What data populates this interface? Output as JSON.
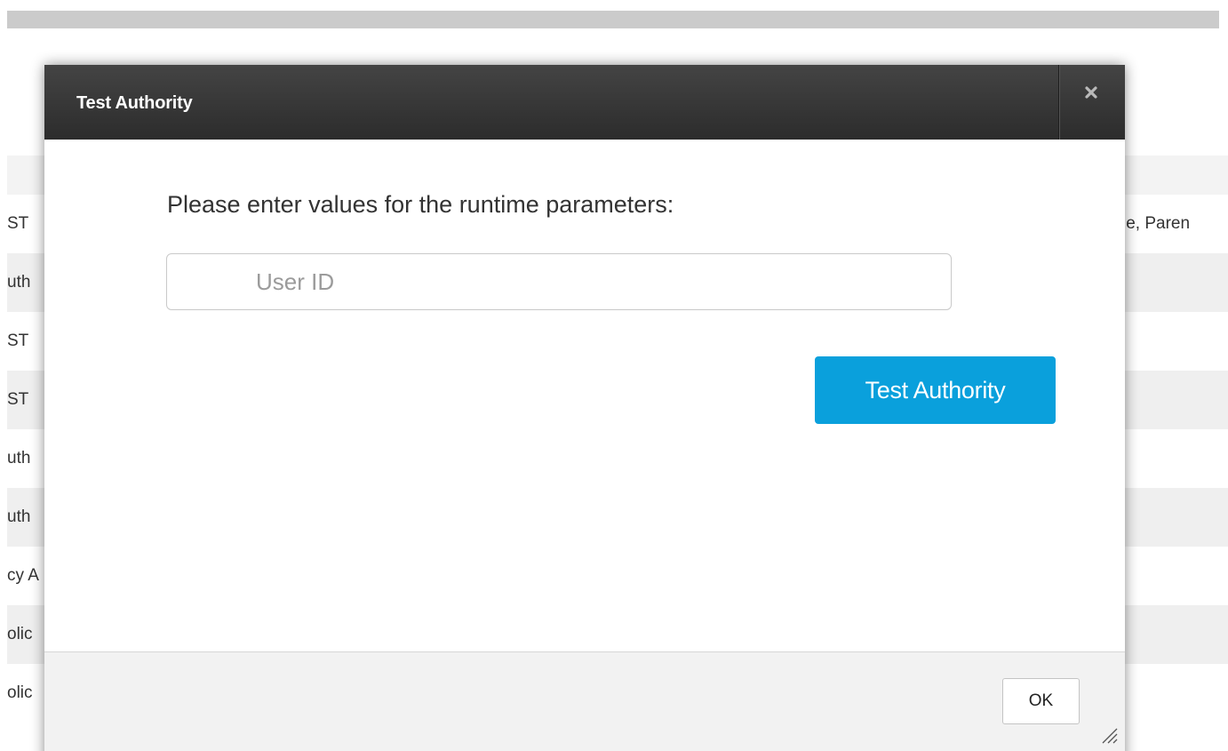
{
  "background": {
    "header_row_label": "",
    "rows": [
      {
        "left": "ST",
        "right": "ie, Paren"
      },
      {
        "left": "uth",
        "right": ""
      },
      {
        "left": "ST",
        "right": ""
      },
      {
        "left": "ST",
        "right": ""
      },
      {
        "left": "uth",
        "right": ""
      },
      {
        "left": "uth",
        "right": ""
      },
      {
        "left": "cy A",
        "right": ""
      },
      {
        "left": "olic",
        "right": ""
      },
      {
        "left": "olic",
        "right": ""
      }
    ]
  },
  "modal": {
    "title": "Test Authority",
    "close_icon": "close-icon",
    "prompt": "Please enter values for the runtime parameters:",
    "user_id": {
      "value": "",
      "placeholder": "User ID"
    },
    "test_button_label": "Test Authority",
    "ok_button_label": "OK"
  },
  "colors": {
    "header_dark": "#333333",
    "accent_button": "#0aa0dc",
    "footer_bg": "#f2f2f2"
  }
}
